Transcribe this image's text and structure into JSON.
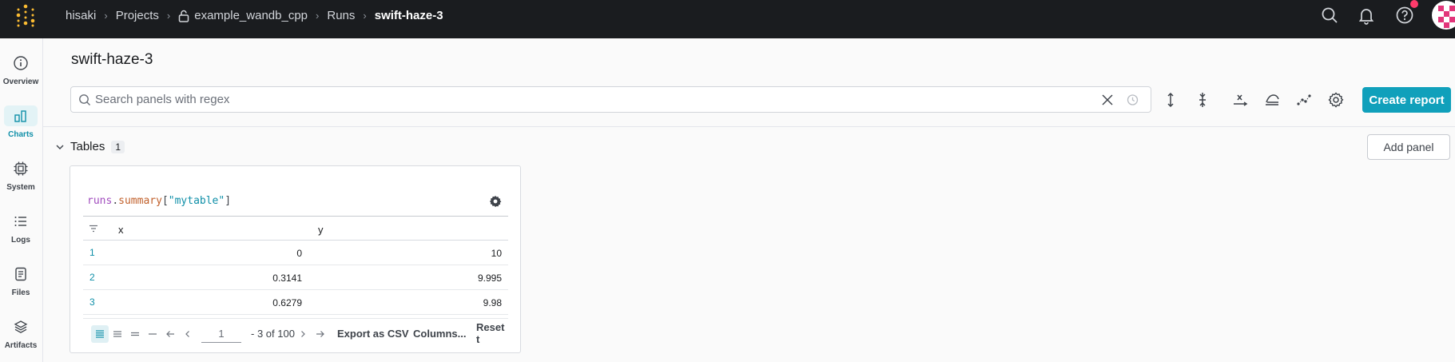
{
  "breadcrumb": {
    "entity": "hisaki",
    "projects": "Projects",
    "project": "example_wandb_cpp",
    "runs": "Runs",
    "run": "swift-haze-3"
  },
  "sidebar": {
    "items": [
      {
        "label": "Overview",
        "icon": "info-icon",
        "active": false
      },
      {
        "label": "Charts",
        "icon": "charts-icon",
        "active": true
      },
      {
        "label": "System",
        "icon": "chip-icon",
        "active": false
      },
      {
        "label": "Logs",
        "icon": "list-icon",
        "active": false
      },
      {
        "label": "Files",
        "icon": "file-icon",
        "active": false
      },
      {
        "label": "Artifacts",
        "icon": "layers-icon",
        "active": false
      }
    ]
  },
  "main": {
    "title": "swift-haze-3",
    "search_placeholder": "Search panels with regex",
    "create_report": "Create report"
  },
  "section": {
    "title": "Tables",
    "count": "1",
    "add_panel": "Add panel"
  },
  "panel": {
    "query": {
      "obj": "runs",
      "dot": ".",
      "prop": "summary",
      "open": "[",
      "str": "\"mytable\"",
      "close": "]"
    },
    "columns": {
      "x": "x",
      "y": "y"
    },
    "rows": [
      {
        "n": "1",
        "x": "0",
        "y": "10"
      },
      {
        "n": "2",
        "x": "0.3141",
        "y": "9.995"
      },
      {
        "n": "3",
        "x": "0.6279",
        "y": "9.98"
      }
    ],
    "pager": {
      "page_value": "1",
      "range_text": "- 3 of 100",
      "export_csv": "Export as CSV",
      "columns": "Columns...",
      "reset": "Reset t"
    }
  },
  "colors": {
    "topbar": "#1a1c1f",
    "accent": "#10a0bb",
    "logo": "#fcbc32",
    "notification": "#ff3b6b",
    "avatar": "#e2357a"
  }
}
